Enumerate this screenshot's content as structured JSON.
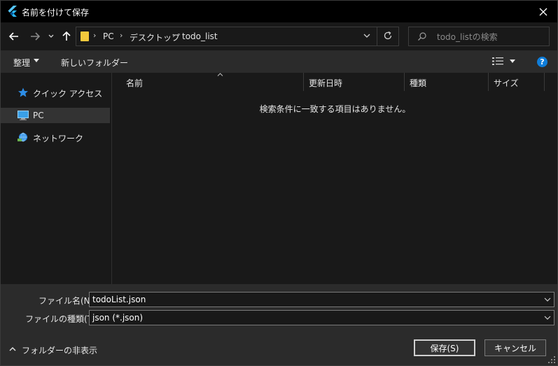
{
  "window": {
    "title": "名前を付けて保存",
    "close_glyph": "✕"
  },
  "address": {
    "crumbs": [
      "PC",
      "デスクトップ",
      "todo_list"
    ],
    "separator": "›"
  },
  "search": {
    "placeholder": "todo_listの検索"
  },
  "toolbar": {
    "organize_label": "整理",
    "new_folder_label": "新しいフォルダー",
    "help_label": "?"
  },
  "sidebar": {
    "items": [
      {
        "label": "クイック アクセス",
        "icon": "star-icon"
      },
      {
        "label": "PC",
        "icon": "pc-icon"
      },
      {
        "label": "ネットワーク",
        "icon": "network-icon"
      }
    ]
  },
  "columns": [
    "名前",
    "更新日時",
    "種類",
    "サイズ"
  ],
  "content": {
    "empty_message": "検索条件に一致する項目はありません。"
  },
  "form": {
    "filename_label": "ファイル名(N):",
    "filename_value": "todoList.json",
    "filetype_label": "ファイルの種類(T):",
    "filetype_value": "json (*.json)"
  },
  "footer": {
    "hide_folders_label": "フォルダーの非表示",
    "save_label": "保存(S)",
    "cancel_label": "キャンセル"
  },
  "colors": {
    "accent": "#0f7dd9",
    "folder": "#f3c83c",
    "background": "#191919",
    "panel": "#2b2b2b"
  }
}
